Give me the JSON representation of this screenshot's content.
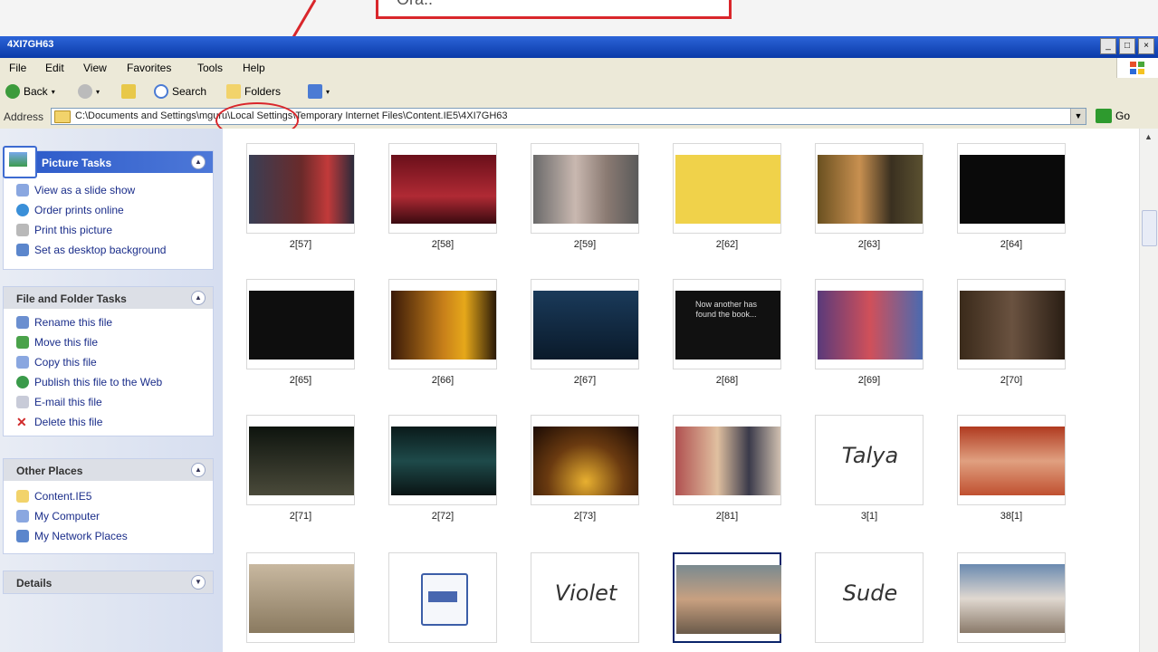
{
  "callout_text": "Ora..",
  "window": {
    "title": "4XI7GH63"
  },
  "menu": [
    "File",
    "Edit",
    "View",
    "Favorites",
    "Tools",
    "Help"
  ],
  "toolbar": {
    "back": "Back",
    "search": "Search",
    "folders": "Folders"
  },
  "address": {
    "label": "Address",
    "value": "C:\\Documents and Settings\\mguru\\Local Settings\\Temporary Internet Files\\Content.IE5\\4XI7GH63",
    "go": "Go"
  },
  "sidebar": {
    "picture_tasks": {
      "title": "Picture Tasks",
      "items": [
        "View as a slide show",
        "Order prints online",
        "Print this picture",
        "Set as desktop background"
      ]
    },
    "file_tasks": {
      "title": "File and Folder Tasks",
      "items": [
        "Rename this file",
        "Move this file",
        "Copy this file",
        "Publish this file to the Web",
        "E-mail this file",
        "Delete this file"
      ]
    },
    "other_places": {
      "title": "Other Places",
      "items": [
        "Content.IE5",
        "My Computer",
        "My Network Places"
      ]
    },
    "details": {
      "title": "Details"
    }
  },
  "thumbnails": [
    {
      "caption": "2[57]"
    },
    {
      "caption": "2[58]"
    },
    {
      "caption": "2[59]"
    },
    {
      "caption": "2[62]"
    },
    {
      "caption": "2[63]"
    },
    {
      "caption": "2[64]"
    },
    {
      "caption": "2[65]"
    },
    {
      "caption": "2[66]"
    },
    {
      "caption": "2[67]"
    },
    {
      "caption": "2[68]",
      "overlay": "Now another has found the book..."
    },
    {
      "caption": "2[69]"
    },
    {
      "caption": "2[70]"
    },
    {
      "caption": "2[71]"
    },
    {
      "caption": "2[72]"
    },
    {
      "caption": "2[73]"
    },
    {
      "caption": "2[81]"
    },
    {
      "caption": "3[1]",
      "text": "Talya"
    },
    {
      "caption": "38[1]"
    },
    {
      "caption": ""
    },
    {
      "caption": ""
    },
    {
      "caption": "",
      "text": "Violet"
    },
    {
      "caption": ""
    },
    {
      "caption": "",
      "text": "Sude"
    },
    {
      "caption": ""
    }
  ],
  "colors": {
    "titlebar": "#0a3aa8",
    "accent": "#d9262b",
    "link": "#1a2d8a"
  }
}
